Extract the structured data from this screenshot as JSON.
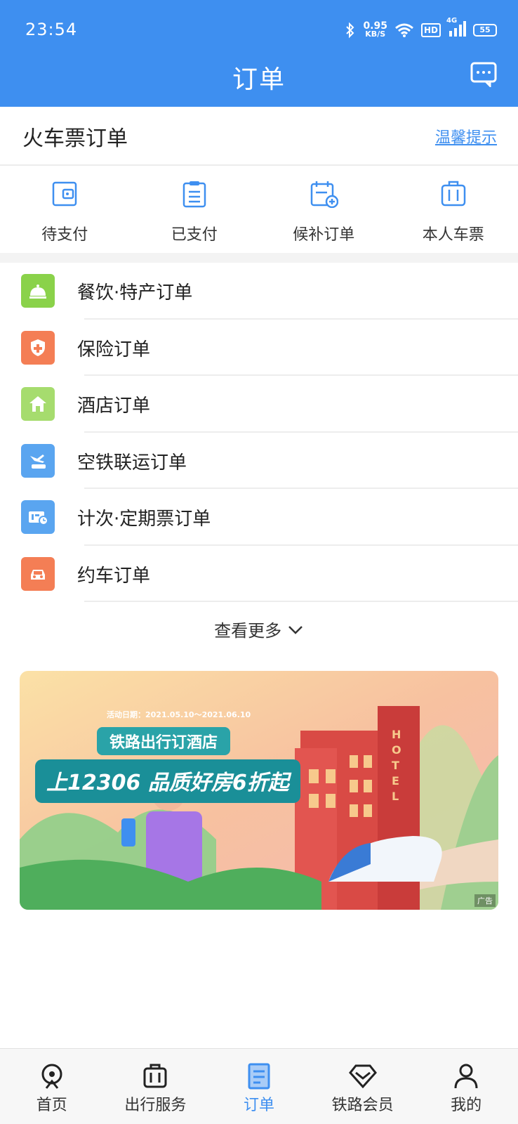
{
  "status_bar": {
    "time": "23:54",
    "speed_value": "0.95",
    "speed_unit": "KB/S",
    "hd": "HD",
    "network": "4G",
    "battery": "55"
  },
  "header": {
    "title": "订单",
    "message_icon": "message-icon"
  },
  "section": {
    "title": "火车票订单",
    "tip_link": "温馨提示"
  },
  "quick_actions": [
    {
      "label": "待支付",
      "icon": "wallet-icon"
    },
    {
      "label": "已支付",
      "icon": "clipboard-icon"
    },
    {
      "label": "候补订单",
      "icon": "calendar-add-icon"
    },
    {
      "label": "本人车票",
      "icon": "suitcase-icon"
    }
  ],
  "menu": [
    {
      "label": "餐饮·特产订单",
      "icon": "food-bell-icon",
      "color": "#8ad24a"
    },
    {
      "label": "保险订单",
      "icon": "shield-icon",
      "color": "#f47e55"
    },
    {
      "label": "酒店订单",
      "icon": "hotel-icon",
      "color": "#a6dc6e"
    },
    {
      "label": "空铁联运订单",
      "icon": "plane-train-icon",
      "color": "#5aa5f0"
    },
    {
      "label": "计次·定期票订单",
      "icon": "ticket-icon",
      "color": "#5aa5f0"
    },
    {
      "label": "约车订单",
      "icon": "car-icon",
      "color": "#f47e55"
    }
  ],
  "more": {
    "label": "查看更多"
  },
  "banner": {
    "date": "活动日期：2021.05.10～2021.06.10",
    "subtitle": "铁路出行订酒店",
    "main": "上12306 品质好房6折起",
    "hotel_sign": "HOTEL",
    "ad_tag": "广告"
  },
  "tabs": [
    {
      "label": "首页",
      "icon": "home-rail-icon",
      "active": false
    },
    {
      "label": "出行服务",
      "icon": "luggage-icon",
      "active": false
    },
    {
      "label": "订单",
      "icon": "order-doc-icon",
      "active": true
    },
    {
      "label": "铁路会员",
      "icon": "diamond-icon",
      "active": false
    },
    {
      "label": "我的",
      "icon": "user-icon",
      "active": false
    }
  ],
  "colors": {
    "primary": "#3e8ff0",
    "text": "#222222",
    "muted": "#f3f3f3"
  }
}
